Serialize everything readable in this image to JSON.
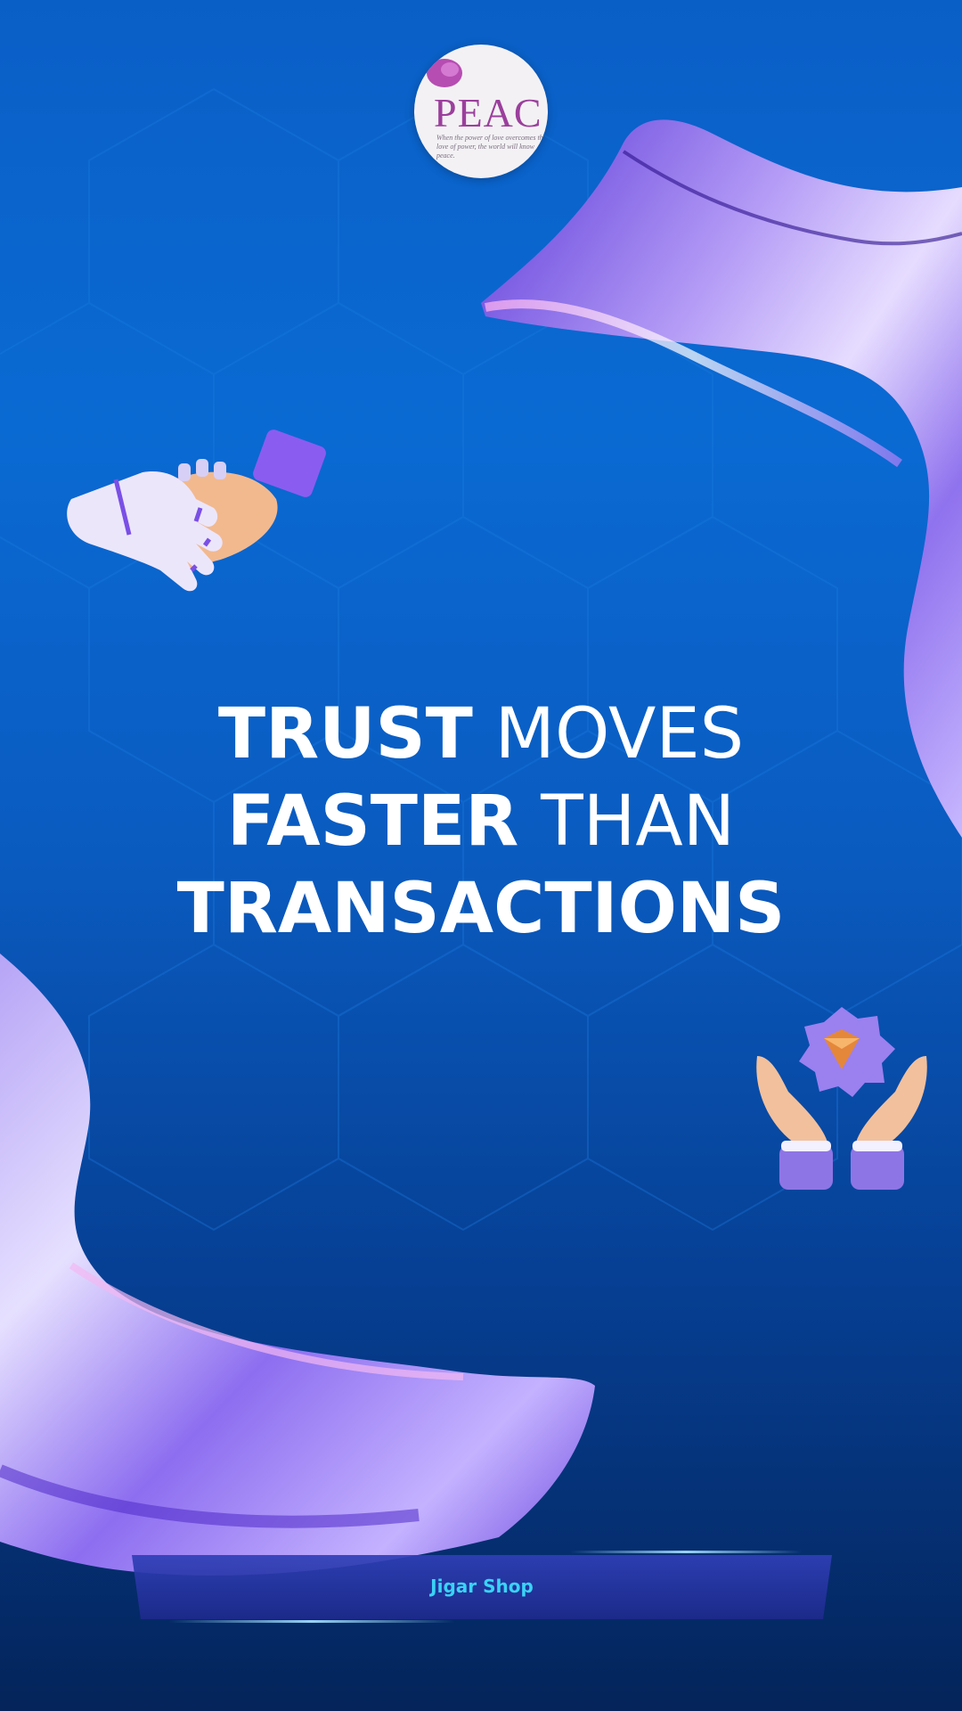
{
  "logo": {
    "wordmark": "PEAC",
    "tagline": "When the power of love overcomes the love of power, the world will know peace."
  },
  "headline": {
    "line1": {
      "bold": "TRUST",
      "thin": "MOVES"
    },
    "line2": {
      "bold": "FASTER",
      "thin": "THAN"
    },
    "line3": {
      "bold": "TRANSACTIONS"
    }
  },
  "banner": {
    "label": "Jigar Shop"
  },
  "icons": {
    "top_left": "robot-human-handshake-icon",
    "right": "hands-holding-diamond-icon"
  },
  "colors": {
    "background_top": "#0a5fc6",
    "background_bottom": "#04245a",
    "accent_purple": "#7d5cf0",
    "banner_text": "#39d3f5"
  }
}
